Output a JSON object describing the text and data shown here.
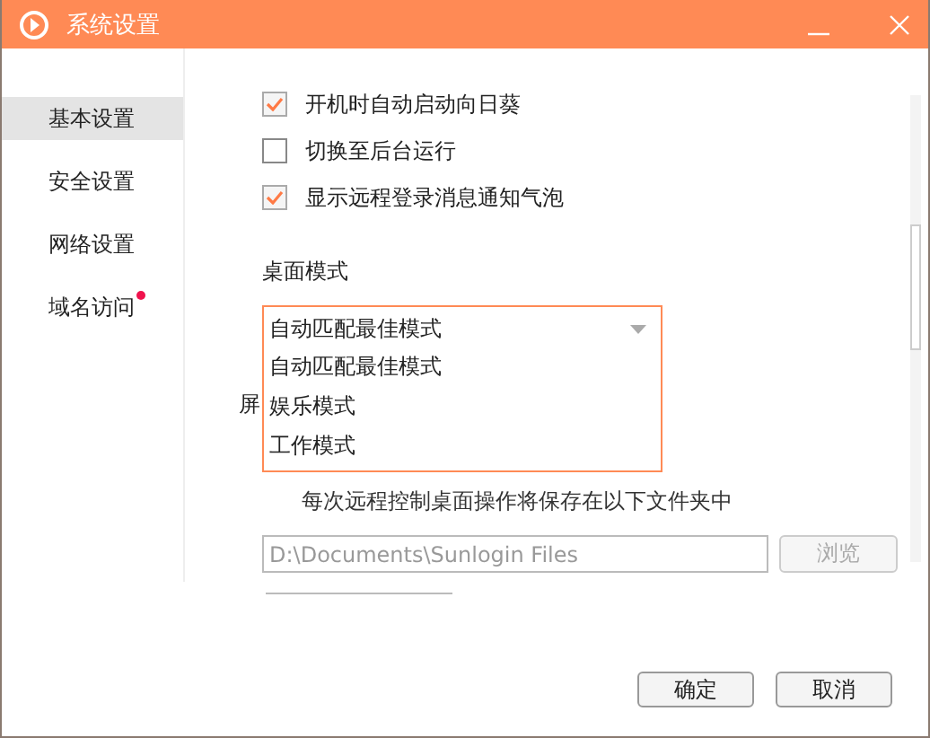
{
  "window": {
    "title": "系统设置"
  },
  "sidebar": {
    "items": [
      {
        "label": "基本设置",
        "selected": true,
        "badge": false
      },
      {
        "label": "安全设置",
        "selected": false,
        "badge": false
      },
      {
        "label": "网络设置",
        "selected": false,
        "badge": false
      },
      {
        "label": "域名访问",
        "selected": false,
        "badge": true
      }
    ]
  },
  "options": [
    {
      "label": "开机时自动启动向日葵",
      "checked": true
    },
    {
      "label": "切换至后台运行",
      "checked": false
    },
    {
      "label": "显示远程登录消息通知气泡",
      "checked": true
    }
  ],
  "desktop_mode": {
    "label": "桌面模式",
    "dropdown": {
      "value": "自动匹配最佳模式",
      "expanded": true,
      "options": [
        "自动匹配最佳模式",
        "娱乐模式",
        "工作模式"
      ]
    }
  },
  "screenshot": {
    "label": "屏",
    "hint": "每次远程控制桌面操作将保存在以下文件夹中",
    "path": "D:\\Documents\\Sunlogin Files",
    "browse": {
      "label": "浏览",
      "disabled": true
    }
  },
  "buttons": [
    {
      "label": "确定"
    },
    {
      "label": "取消"
    }
  ]
}
